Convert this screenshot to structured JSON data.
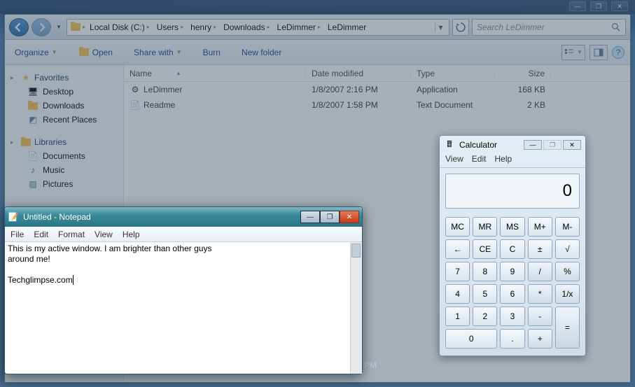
{
  "taskbar": {
    "min": "—",
    "max": "❐",
    "close": "✕"
  },
  "addr": {
    "crumbs": [
      "Local Disk (C:)",
      "Users",
      "henry",
      "Downloads",
      "LeDimmer",
      "LeDimmer"
    ],
    "search_placeholder": "Search LeDimmer"
  },
  "toolbar": {
    "organize": "Organize",
    "open": "Open",
    "share": "Share with",
    "burn": "Burn",
    "newfolder": "New folder"
  },
  "nav": {
    "favorites": "Favorites",
    "items_fav": [
      "Desktop",
      "Downloads",
      "Recent Places"
    ],
    "libraries": "Libraries",
    "items_lib": [
      "Documents",
      "Music",
      "Pictures"
    ]
  },
  "cols": {
    "name": "Name",
    "date": "Date modified",
    "type": "Type",
    "size": "Size"
  },
  "files": [
    {
      "name": "LeDimmer",
      "date": "1/8/2007 2:16 PM",
      "type": "Application",
      "size": "168 KB"
    },
    {
      "name": "Readme",
      "date": "1/8/2007 1:58 PM",
      "type": "Text Document",
      "size": "2 KB"
    }
  ],
  "calc": {
    "title": "Calculator",
    "menu": [
      "View",
      "Edit",
      "Help"
    ],
    "display": "0",
    "keys_row1": [
      "MC",
      "MR",
      "MS",
      "M+",
      "M-"
    ],
    "keys_row2": [
      "←",
      "CE",
      "C",
      "±",
      "√"
    ],
    "keys_row3": [
      "7",
      "8",
      "9",
      "/",
      "%"
    ],
    "keys_row4": [
      "4",
      "5",
      "6",
      "*",
      "1/x"
    ],
    "keys_row5": [
      "1",
      "2",
      "3",
      "-",
      "="
    ],
    "keys_row6": [
      "0",
      ".",
      "+"
    ]
  },
  "notepad": {
    "title": "Untitled - Notepad",
    "menu": [
      "File",
      "Edit",
      "Format",
      "View",
      "Help"
    ],
    "text": "This is my active window. I am brighter than other guys\naround me!\n\nTechglimpse.com"
  },
  "stray": {
    "pm": " PM"
  }
}
